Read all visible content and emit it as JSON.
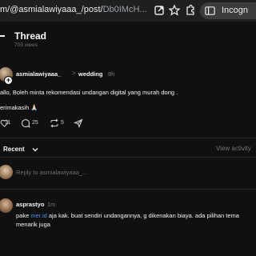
{
  "browser": {
    "url_path": "m/@asmialawiyaaa_/post/",
    "url_id": "Db0IMcH...",
    "incognito_label": "Incogn",
    "icons": [
      "share-icon",
      "star-icon",
      "extensions-icon",
      "sidebar-icon"
    ]
  },
  "header": {
    "title": "Thread",
    "views": "703 views"
  },
  "post": {
    "username": "asmialawiyaaa_",
    "separator": ">",
    "topic": "wedding",
    "time": "8h",
    "body": "allo, Boleh minta rekomendasi undangan digital yang murah dong .",
    "thanks": "erimakasih 🙏🏻",
    "likes": "11",
    "comments": "25",
    "reposts": "5"
  },
  "recent": {
    "label": "Recent",
    "view_activity": "View activity"
  },
  "reply": {
    "placeholder": "Reply to asmialawiyaaa_..."
  },
  "comment": {
    "username": "asprastyo",
    "time": "1m",
    "pre_link": "pake ",
    "link": "mer.id",
    "post_link": " aja kak. buat sendiri undangannya, g dikenakan biaya. ada pilihan tema menarik juga"
  },
  "colors": {
    "background": "#101010",
    "text": "#f3f5f7",
    "muted": "#777777",
    "link": "#4e8cf0"
  }
}
